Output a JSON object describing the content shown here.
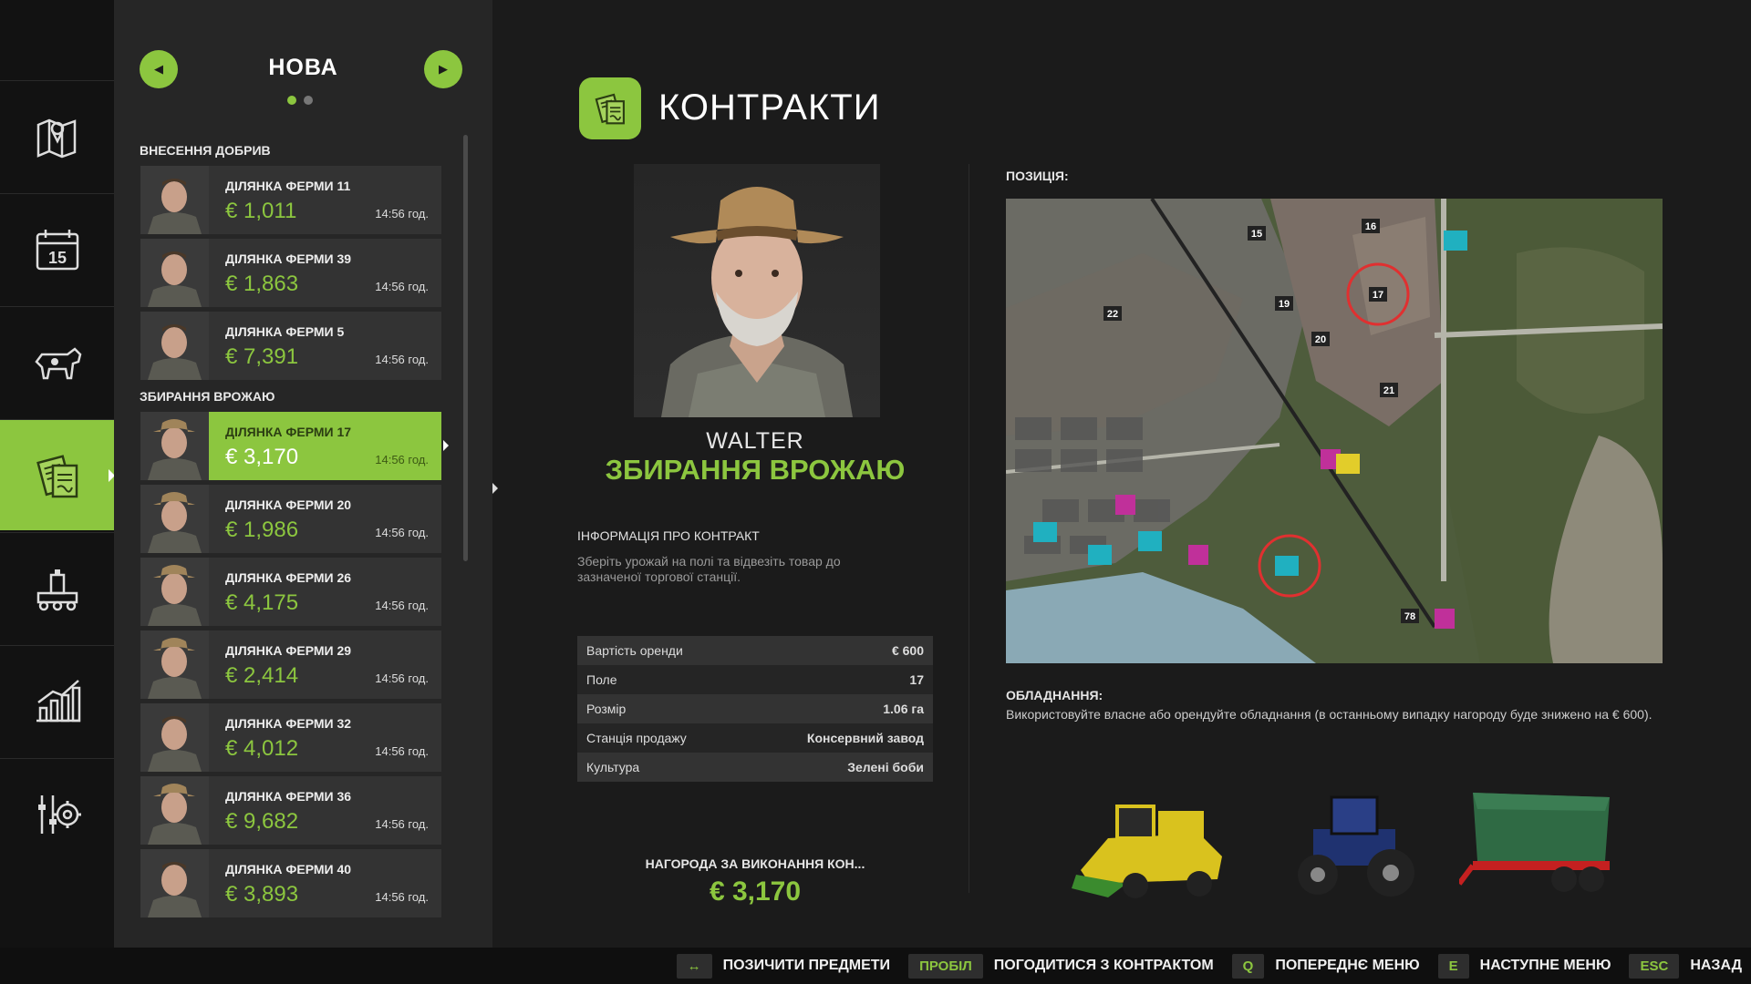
{
  "list": {
    "title": "НОВА",
    "categories": [
      "ВНЕСЕННЯ ДОБРИВ",
      "ЗБИРАННЯ ВРОЖАЮ"
    ],
    "contracts": [
      {
        "title": "ДІЛЯНКА ФЕРМИ 11",
        "price": "€ 1,011",
        "time": "14:56 год."
      },
      {
        "title": "ДІЛЯНКА ФЕРМИ 39",
        "price": "€ 1,863",
        "time": "14:56 год."
      },
      {
        "title": "ДІЛЯНКА ФЕРМИ 5",
        "price": "€ 7,391",
        "time": "14:56 год."
      },
      {
        "title": "ДІЛЯНКА ФЕРМИ 17",
        "price": "€ 3,170",
        "time": "14:56 год."
      },
      {
        "title": "ДІЛЯНКА ФЕРМИ 20",
        "price": "€ 1,986",
        "time": "14:56 год."
      },
      {
        "title": "ДІЛЯНКА ФЕРМИ 26",
        "price": "€ 4,175",
        "time": "14:56 год."
      },
      {
        "title": "ДІЛЯНКА ФЕРМИ 29",
        "price": "€ 2,414",
        "time": "14:56 год."
      },
      {
        "title": "ДІЛЯНКА ФЕРМИ 32",
        "price": "€ 4,012",
        "time": "14:56 год."
      },
      {
        "title": "ДІЛЯНКА ФЕРМИ 36",
        "price": "€ 9,682",
        "time": "14:56 год."
      },
      {
        "title": "ДІЛЯНКА ФЕРМИ 40",
        "price": "€ 3,893",
        "time": "14:56 год."
      }
    ]
  },
  "main": {
    "title": "КОНТРАКТИ",
    "npc_name": "WALTER",
    "contract_type": "ЗБИРАННЯ ВРОЖАЮ",
    "info_title": "ІНФОРМАЦІЯ ПРО КОНТРАКТ",
    "info_desc": "Зберіть урожай на полі та відвезіть товар до зазначеної торгової станції.",
    "details": [
      {
        "label": "Вартість оренди",
        "value": "€ 600"
      },
      {
        "label": "Поле",
        "value": "17"
      },
      {
        "label": "Розмір",
        "value": "1.06 га"
      },
      {
        "label": "Станція продажу",
        "value": "Консервний завод"
      },
      {
        "label": "Культура",
        "value": "Зелені боби"
      }
    ],
    "reward_label": "НАГОРОДА ЗА ВИКОНАННЯ КОН...",
    "reward_value": "€ 3,170",
    "position_label": "ПОЗИЦІЯ:",
    "equipment_label": "ОБЛАДНАННЯ:",
    "equipment_desc": "Використовуйте власне або орендуйте обладнання (в останньому випадку нагороду буде знижено на € 600).",
    "map_labels": [
      "15",
      "16",
      "17",
      "19",
      "20",
      "21",
      "22",
      "78"
    ]
  },
  "hints": [
    {
      "key": "↔",
      "label": "ПОЗИЧИТИ ПРЕДМЕТИ"
    },
    {
      "key": "ПРОБІЛ",
      "label": "ПОГОДИТИСЯ З КОНТРАКТОМ"
    },
    {
      "key": "Q",
      "label": "ПОПЕРЕДНЄ МЕНЮ"
    },
    {
      "key": "E",
      "label": "НАСТУПНЕ МЕНЮ"
    },
    {
      "key": "ESC",
      "label": "НАЗАД"
    }
  ],
  "colors": {
    "accent": "#8cc63f",
    "background": "#1b1b1b",
    "panel": "#262626"
  },
  "icons": [
    "map-icon",
    "calendar-icon",
    "animals-icon",
    "contracts-icon",
    "production-icon",
    "statistics-icon",
    "settings-icon"
  ],
  "calendar_day": "15"
}
